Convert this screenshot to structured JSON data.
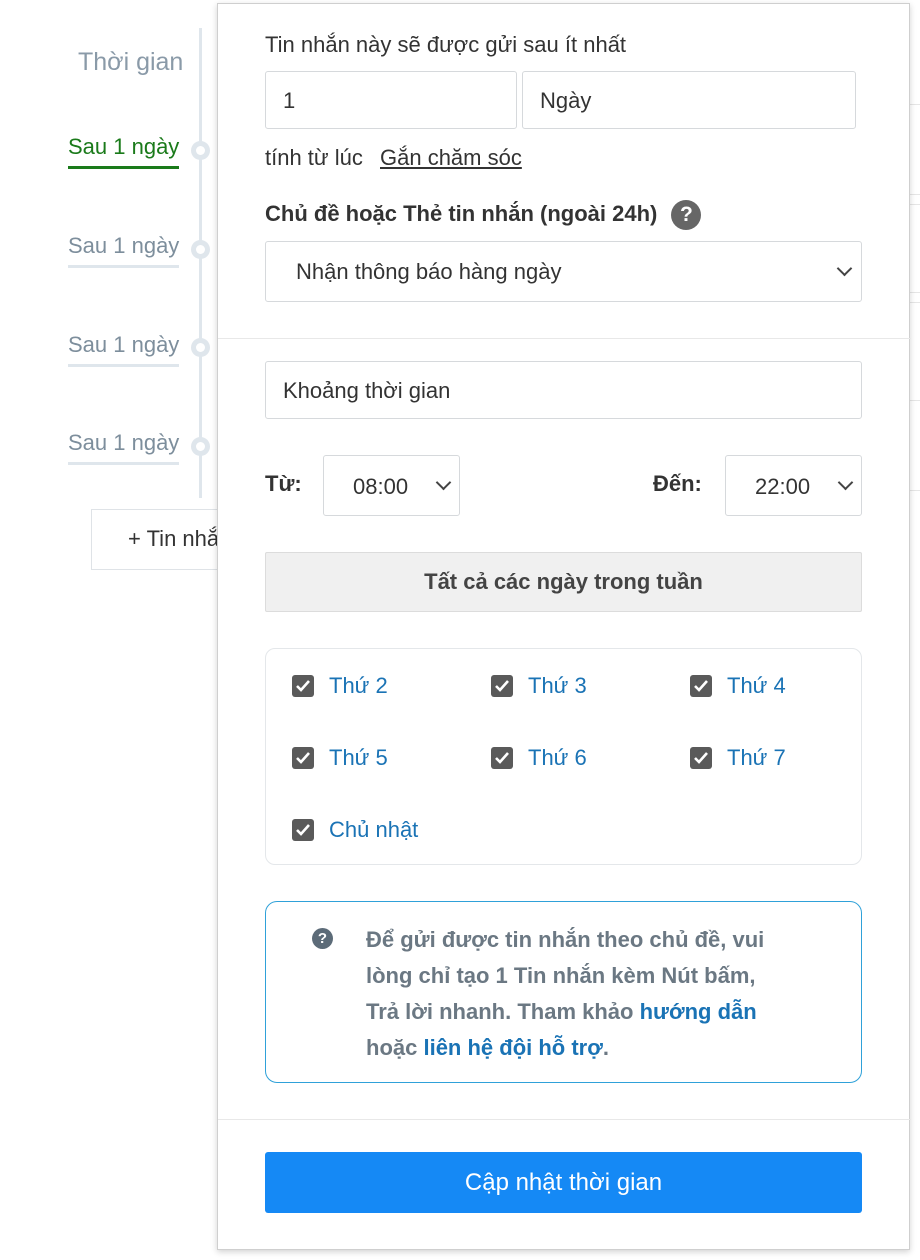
{
  "timeline": {
    "title": "Thời gian",
    "items": [
      {
        "label": "Sau 1 ngày",
        "active": true
      },
      {
        "label": "Sau 1 ngày",
        "active": false
      },
      {
        "label": "Sau 1 ngày",
        "active": false
      },
      {
        "label": "Sau 1 ngày",
        "active": false
      }
    ],
    "add_button": "+ Tin nhắn"
  },
  "popup": {
    "delay_intro": "Tin nhắn này sẽ được gửi sau ít nhất",
    "delay_value": "1",
    "delay_unit": "Ngày",
    "from_prefix": "tính từ lúc",
    "from_link": "Gắn chăm sóc",
    "topic_label": "Chủ đề hoặc Thẻ tin nhắn (ngoài 24h)",
    "topic_help_icon": "question-circle-icon",
    "topic_selected": "Nhận thông báo hàng ngày",
    "time_range_value": "Khoảng thời gian",
    "from_label": "Từ:",
    "from_time": "08:00",
    "to_label": "Đến:",
    "to_time": "22:00",
    "all_days_button": "Tất cả các ngày trong tuần",
    "days": [
      {
        "label": "Thứ 2",
        "checked": true
      },
      {
        "label": "Thứ 3",
        "checked": true
      },
      {
        "label": "Thứ 4",
        "checked": true
      },
      {
        "label": "Thứ 5",
        "checked": true
      },
      {
        "label": "Thứ 6",
        "checked": true
      },
      {
        "label": "Thứ 7",
        "checked": true
      },
      {
        "label": "Chủ nhật",
        "checked": true
      }
    ],
    "info": {
      "icon": "question-circle-icon",
      "text_part1": "Để gửi được tin nhắn theo chủ đề, vui lòng chỉ tạo 1 Tin nhắn kèm Nút bấm, Trả lời nhanh. Tham khảo ",
      "link_guide": "hướng dẫn",
      "text_part2": " hoặc ",
      "link_support": "liên hệ đội hỗ trợ",
      "text_part3": "."
    },
    "submit_button": "Cập nhật thời gian"
  },
  "colors": {
    "primary": "#1589f5",
    "link": "#1a73b5",
    "active_green": "#1a7a1a",
    "info_border": "#2fa1d9"
  }
}
